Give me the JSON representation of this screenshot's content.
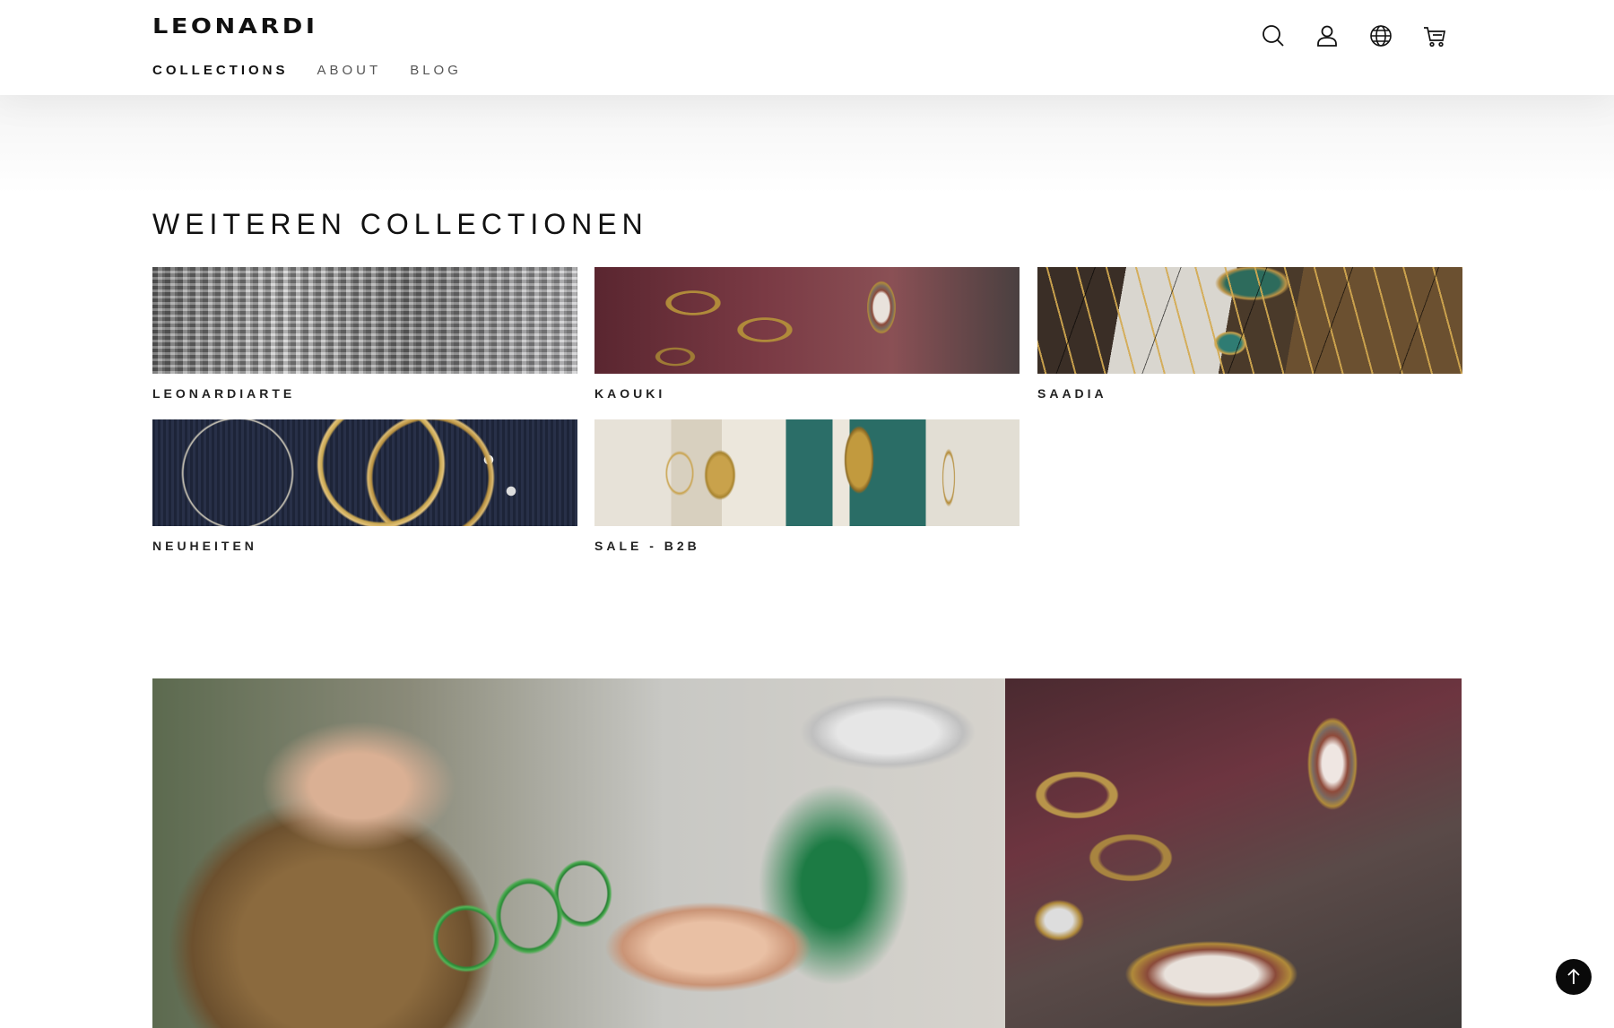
{
  "header": {
    "logo": "LEONARDI",
    "nav": [
      {
        "label": "COLLECTIONS",
        "active": true
      },
      {
        "label": "ABOUT",
        "active": false
      },
      {
        "label": "BLOG",
        "active": false
      }
    ],
    "icons": [
      "search-icon",
      "account-icon",
      "globe-icon",
      "cart-icon"
    ]
  },
  "section": {
    "title": "WEITEREN COLLECTIONEN",
    "collections": [
      {
        "label": "LEONARDIARTE"
      },
      {
        "label": "KAOUKI"
      },
      {
        "label": "SAADIA"
      },
      {
        "label": "NEUHEITEN"
      },
      {
        "label": "SALE - B2B"
      }
    ]
  },
  "hero": {
    "left_image": "artisan-making-beaded-earrings",
    "right_image": "gold-chains-and-agate-jewelry"
  },
  "scroll_top": {
    "icon": "arrow-up-icon"
  },
  "colors": {
    "text": "#111111",
    "background": "#ffffff",
    "button": "#0a0a0a"
  }
}
